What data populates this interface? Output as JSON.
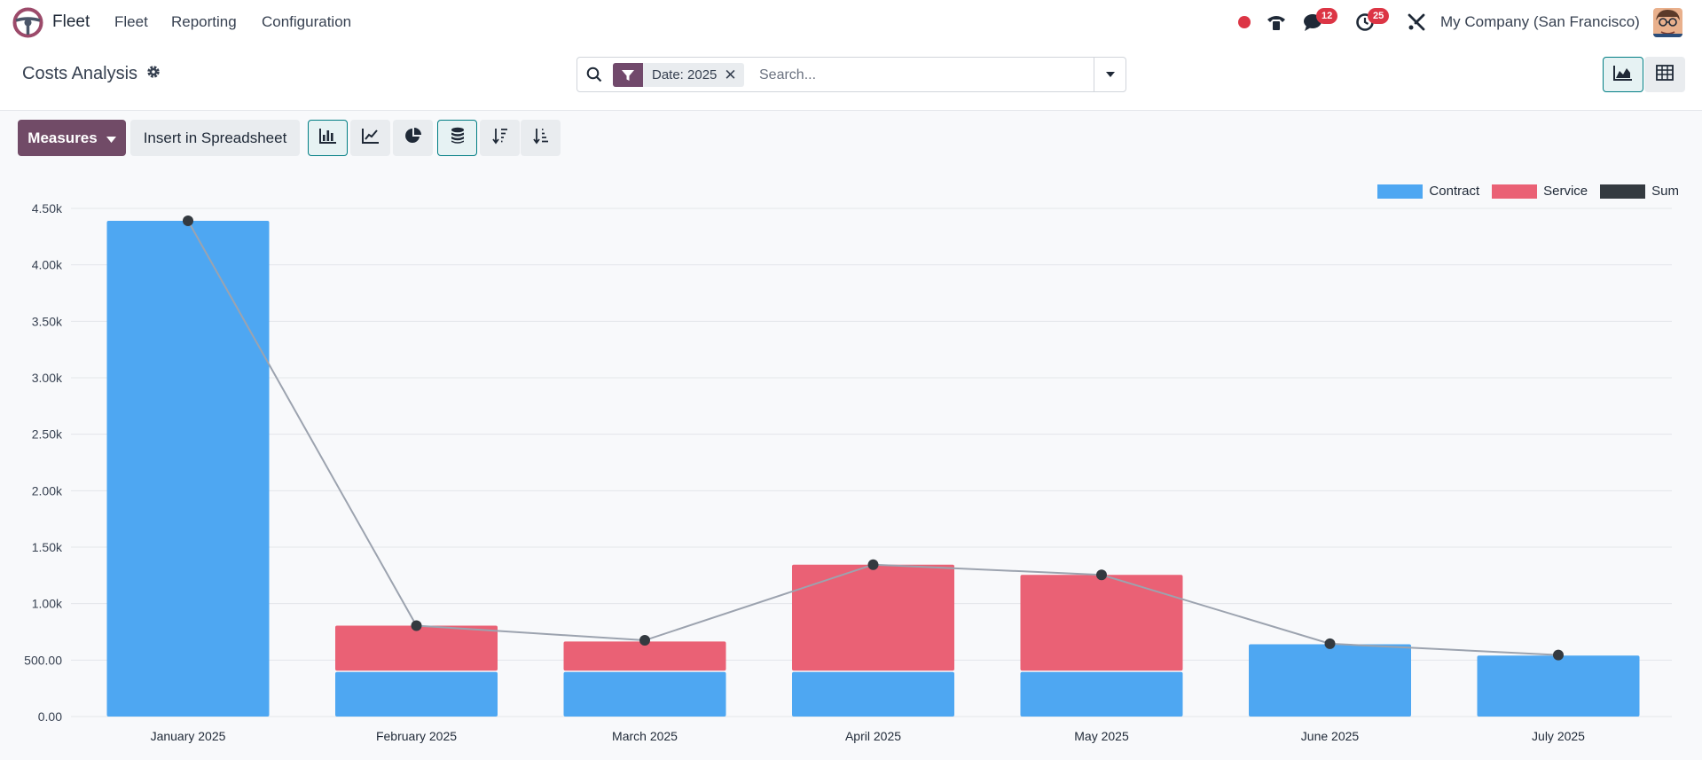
{
  "navbar": {
    "app_name": "Fleet",
    "menus": [
      "Fleet",
      "Reporting",
      "Configuration"
    ],
    "messages_count": "12",
    "activities_count": "25",
    "company": "My Company (San Francisco)"
  },
  "control_panel": {
    "title": "Costs Analysis",
    "facet_label": "Date: 2025",
    "facet_remove": "✕",
    "search_placeholder": "Search..."
  },
  "toolbar": {
    "measures_label": "Measures",
    "insert_label": "Insert in Spreadsheet"
  },
  "colors": {
    "brand": "#714b67",
    "accent": "#017e84",
    "contract": "#4ea7f2",
    "service": "#ea6175",
    "sum": "#343a40"
  },
  "chart_data": {
    "type": "bar",
    "stacked": true,
    "categories": [
      "January 2025",
      "February 2025",
      "March 2025",
      "April 2025",
      "May 2025",
      "June 2025",
      "July 2025"
    ],
    "series": [
      {
        "name": "Contract",
        "type": "bar",
        "color": "#4ea7f2",
        "values": [
          4390,
          395,
          395,
          395,
          395,
          640,
          540
        ]
      },
      {
        "name": "Service",
        "type": "bar",
        "color": "#ea6175",
        "values": [
          0,
          410,
          270,
          950,
          860,
          0,
          0
        ]
      },
      {
        "name": "Sum",
        "type": "line",
        "color": "#343a40",
        "values": [
          4390,
          805,
          675,
          1345,
          1255,
          645,
          545
        ]
      }
    ],
    "yticks": [
      "0.00",
      "500.00",
      "1.00k",
      "1.50k",
      "2.00k",
      "2.50k",
      "3.00k",
      "3.50k",
      "4.00k",
      "4.50k"
    ],
    "ylim": [
      0,
      4500
    ],
    "grid": true,
    "legend_position": "top-right"
  }
}
